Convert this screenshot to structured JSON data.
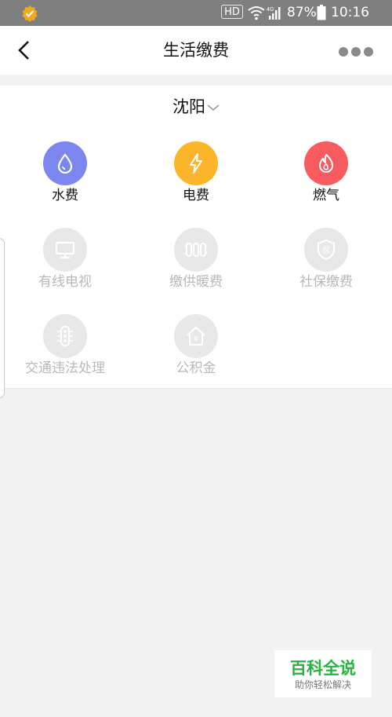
{
  "status_bar": {
    "hd": "HD",
    "network": "4G",
    "battery": "87%",
    "time": "10:16"
  },
  "header": {
    "title": "生活缴费"
  },
  "city": {
    "name": "沈阳"
  },
  "services": [
    {
      "label": "水费",
      "icon": "water-drop-icon",
      "color": "#7b86ee",
      "enabled": true
    },
    {
      "label": "电费",
      "icon": "lightning-icon",
      "color": "#fbb52b",
      "enabled": true
    },
    {
      "label": "燃气",
      "icon": "flame-icon",
      "color": "#f75b5f",
      "enabled": true
    },
    {
      "label": "有线电视",
      "icon": "tv-monitor-icon",
      "color": "#e8e8e8",
      "enabled": false
    },
    {
      "label": "缴供暖费",
      "icon": "radiator-icon",
      "color": "#e8e8e8",
      "enabled": false
    },
    {
      "label": "社保缴费",
      "icon": "shield-bao-icon",
      "color": "#e8e8e8",
      "enabled": false
    },
    {
      "label": "交通违法处理",
      "icon": "traffic-light-icon",
      "color": "#e8e8e8",
      "enabled": false
    },
    {
      "label": "公积金",
      "icon": "house-yuan-icon",
      "color": "#e8e8e8",
      "enabled": false
    }
  ],
  "watermark": {
    "title": "百科全说",
    "subtitle": "助你轻松解决"
  }
}
